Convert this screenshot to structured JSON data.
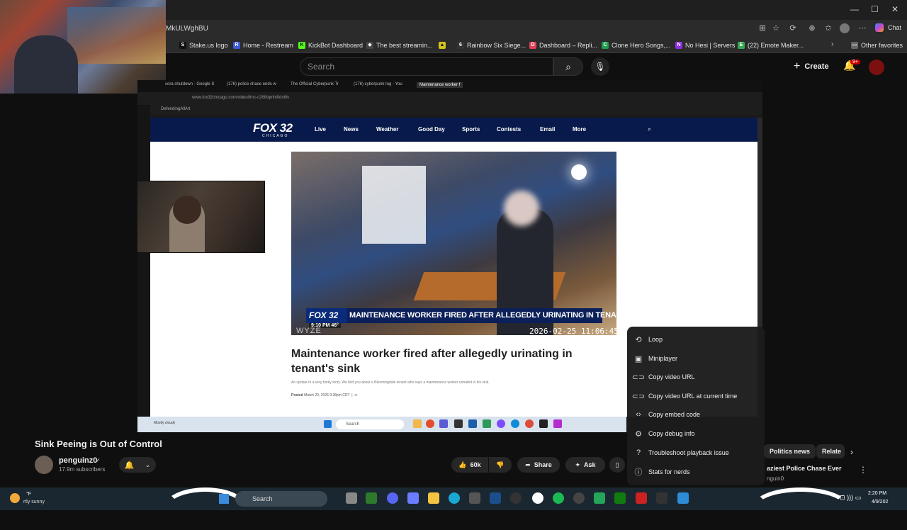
{
  "browser": {
    "url_fragment": "MkULWghBU",
    "window_controls": [
      "—",
      "☐",
      "✕"
    ],
    "chat_label": "Chat"
  },
  "bookmarks": [
    {
      "label": "Stake.us logo",
      "color": "#111111",
      "glyph": "S"
    },
    {
      "label": "Home - Restream",
      "color": "#3b5bdb",
      "glyph": "R"
    },
    {
      "label": "KickBot Dashboard",
      "color": "#53fc18",
      "glyph": "K"
    },
    {
      "label": "The best streamin...",
      "color": "#444444",
      "glyph": "◆"
    },
    {
      "label": "",
      "color": "#d4c21c",
      "glyph": "▲"
    },
    {
      "label": "Rainbow Six Siege...",
      "color": "#333333",
      "glyph": "6"
    },
    {
      "label": "Dashboard – Repli...",
      "color": "#e0405a",
      "glyph": "D"
    },
    {
      "label": "Clone Hero Songs,...",
      "color": "#1e9e4f",
      "glyph": "C"
    },
    {
      "label": "No Hesi | Servers",
      "color": "#8e2de2",
      "glyph": "N"
    },
    {
      "label": "(22) Emote Maker...",
      "color": "#34a853",
      "glyph": "E"
    }
  ],
  "bookmarks_other": "Other favorites",
  "youtube": {
    "search_placeholder": "Search",
    "create_label": "Create",
    "notif_count": "9+"
  },
  "inner_browser": {
    "tabs": [
      "sora shutdown - Google S",
      "(176) police chase ends w",
      "The Official Cyberpunk Tr",
      "(176) cyberpunk tog - You",
      "Maintenance worker f"
    ],
    "url": "www.fox32chicago.com/video/fmc-c2t98qmhl0ds6lv",
    "bookmark": "DefendingAllArt"
  },
  "fox": {
    "logo": "FOX 32",
    "logo_sub": "CHICAGO",
    "nav": [
      "Live",
      "News",
      "Weather",
      "Good Day",
      "Sports",
      "Contests",
      "Email",
      "More"
    ],
    "chyron_logo": "FOX 32",
    "chyron": "MAINTENANCE WORKER FIRED AFTER ALLEGEDLY URINATING IN TENANT'S SINK",
    "chyron_time": "9:10 PM  46°",
    "cam_brand": "WYZE",
    "cam_stamp": "2026-02-25  11:06:45",
    "headline": "Maintenance worker fired after allegedly urinating in tenant's sink",
    "subtext": "An update to a very funky story. We told you about a Bloomingdale tenant who says a maintenance worker urinated in his sink.",
    "posted_label": "Posted",
    "posted_date": "March 20, 2026 9:28pm CDT"
  },
  "inner_taskbar": {
    "search": "Search",
    "weather": "Mostly cloudy"
  },
  "context_menu": [
    {
      "icon": "loop-icon",
      "glyph": "⟲",
      "label": "Loop"
    },
    {
      "icon": "miniplayer-icon",
      "glyph": "▣",
      "label": "Miniplayer"
    },
    {
      "icon": "link-icon",
      "glyph": "⊂⊃",
      "label": "Copy video URL"
    },
    {
      "icon": "link-icon",
      "glyph": "⊂⊃",
      "label": "Copy video URL at current time"
    },
    {
      "icon": "embed-icon",
      "glyph": "‹›",
      "label": "Copy embed code"
    },
    {
      "icon": "gear-icon",
      "glyph": "⚙",
      "label": "Copy debug info"
    },
    {
      "icon": "help-icon",
      "glyph": "?",
      "label": "Troubleshoot playback issue"
    },
    {
      "icon": "info-icon",
      "glyph": "i",
      "label": "Stats for nerds"
    }
  ],
  "video": {
    "title": "Sink Peeing is Out of Control",
    "channel": "penguinz0",
    "subscribers": "17.9m subscribers",
    "likes": "60k",
    "share": "Share",
    "ask": "Ask"
  },
  "sidebar": {
    "chips": [
      "Politics news",
      "Relate"
    ],
    "related_title": "aziest Police Chase Ever",
    "related_channel": "nguin0"
  },
  "taskbar": {
    "weather_temp": "°F",
    "weather_desc": "rtly sunny",
    "search": "Search",
    "time": "2:20 PM",
    "date": "4/9/202"
  }
}
